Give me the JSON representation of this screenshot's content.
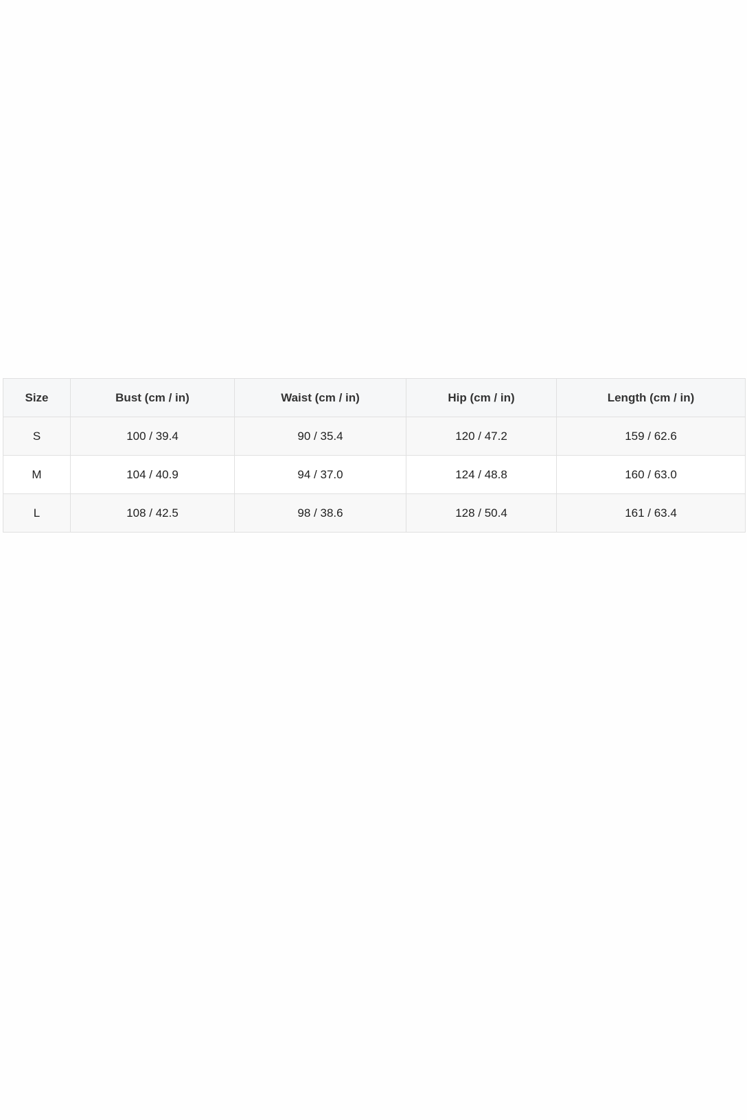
{
  "size_chart": {
    "headers": [
      "Size",
      "Bust (cm / in)",
      "Waist (cm / in)",
      "Hip (cm / in)",
      "Length (cm / in)"
    ],
    "rows": [
      [
        "S",
        "100 / 39.4",
        "90 / 35.4",
        "120 / 47.2",
        "159 / 62.6"
      ],
      [
        "M",
        "104 / 40.9",
        "94 / 37.0",
        "124 / 48.8",
        "160 / 63.0"
      ],
      [
        "L",
        "108 / 42.5",
        "98 / 38.6",
        "128 / 50.4",
        "161 / 63.4"
      ]
    ]
  },
  "colors": {
    "header_bg": "#f6f7f8",
    "border": "#e0e0e0",
    "row_alt_bg": "#f8f8f8",
    "text": "#1f1f1f"
  }
}
